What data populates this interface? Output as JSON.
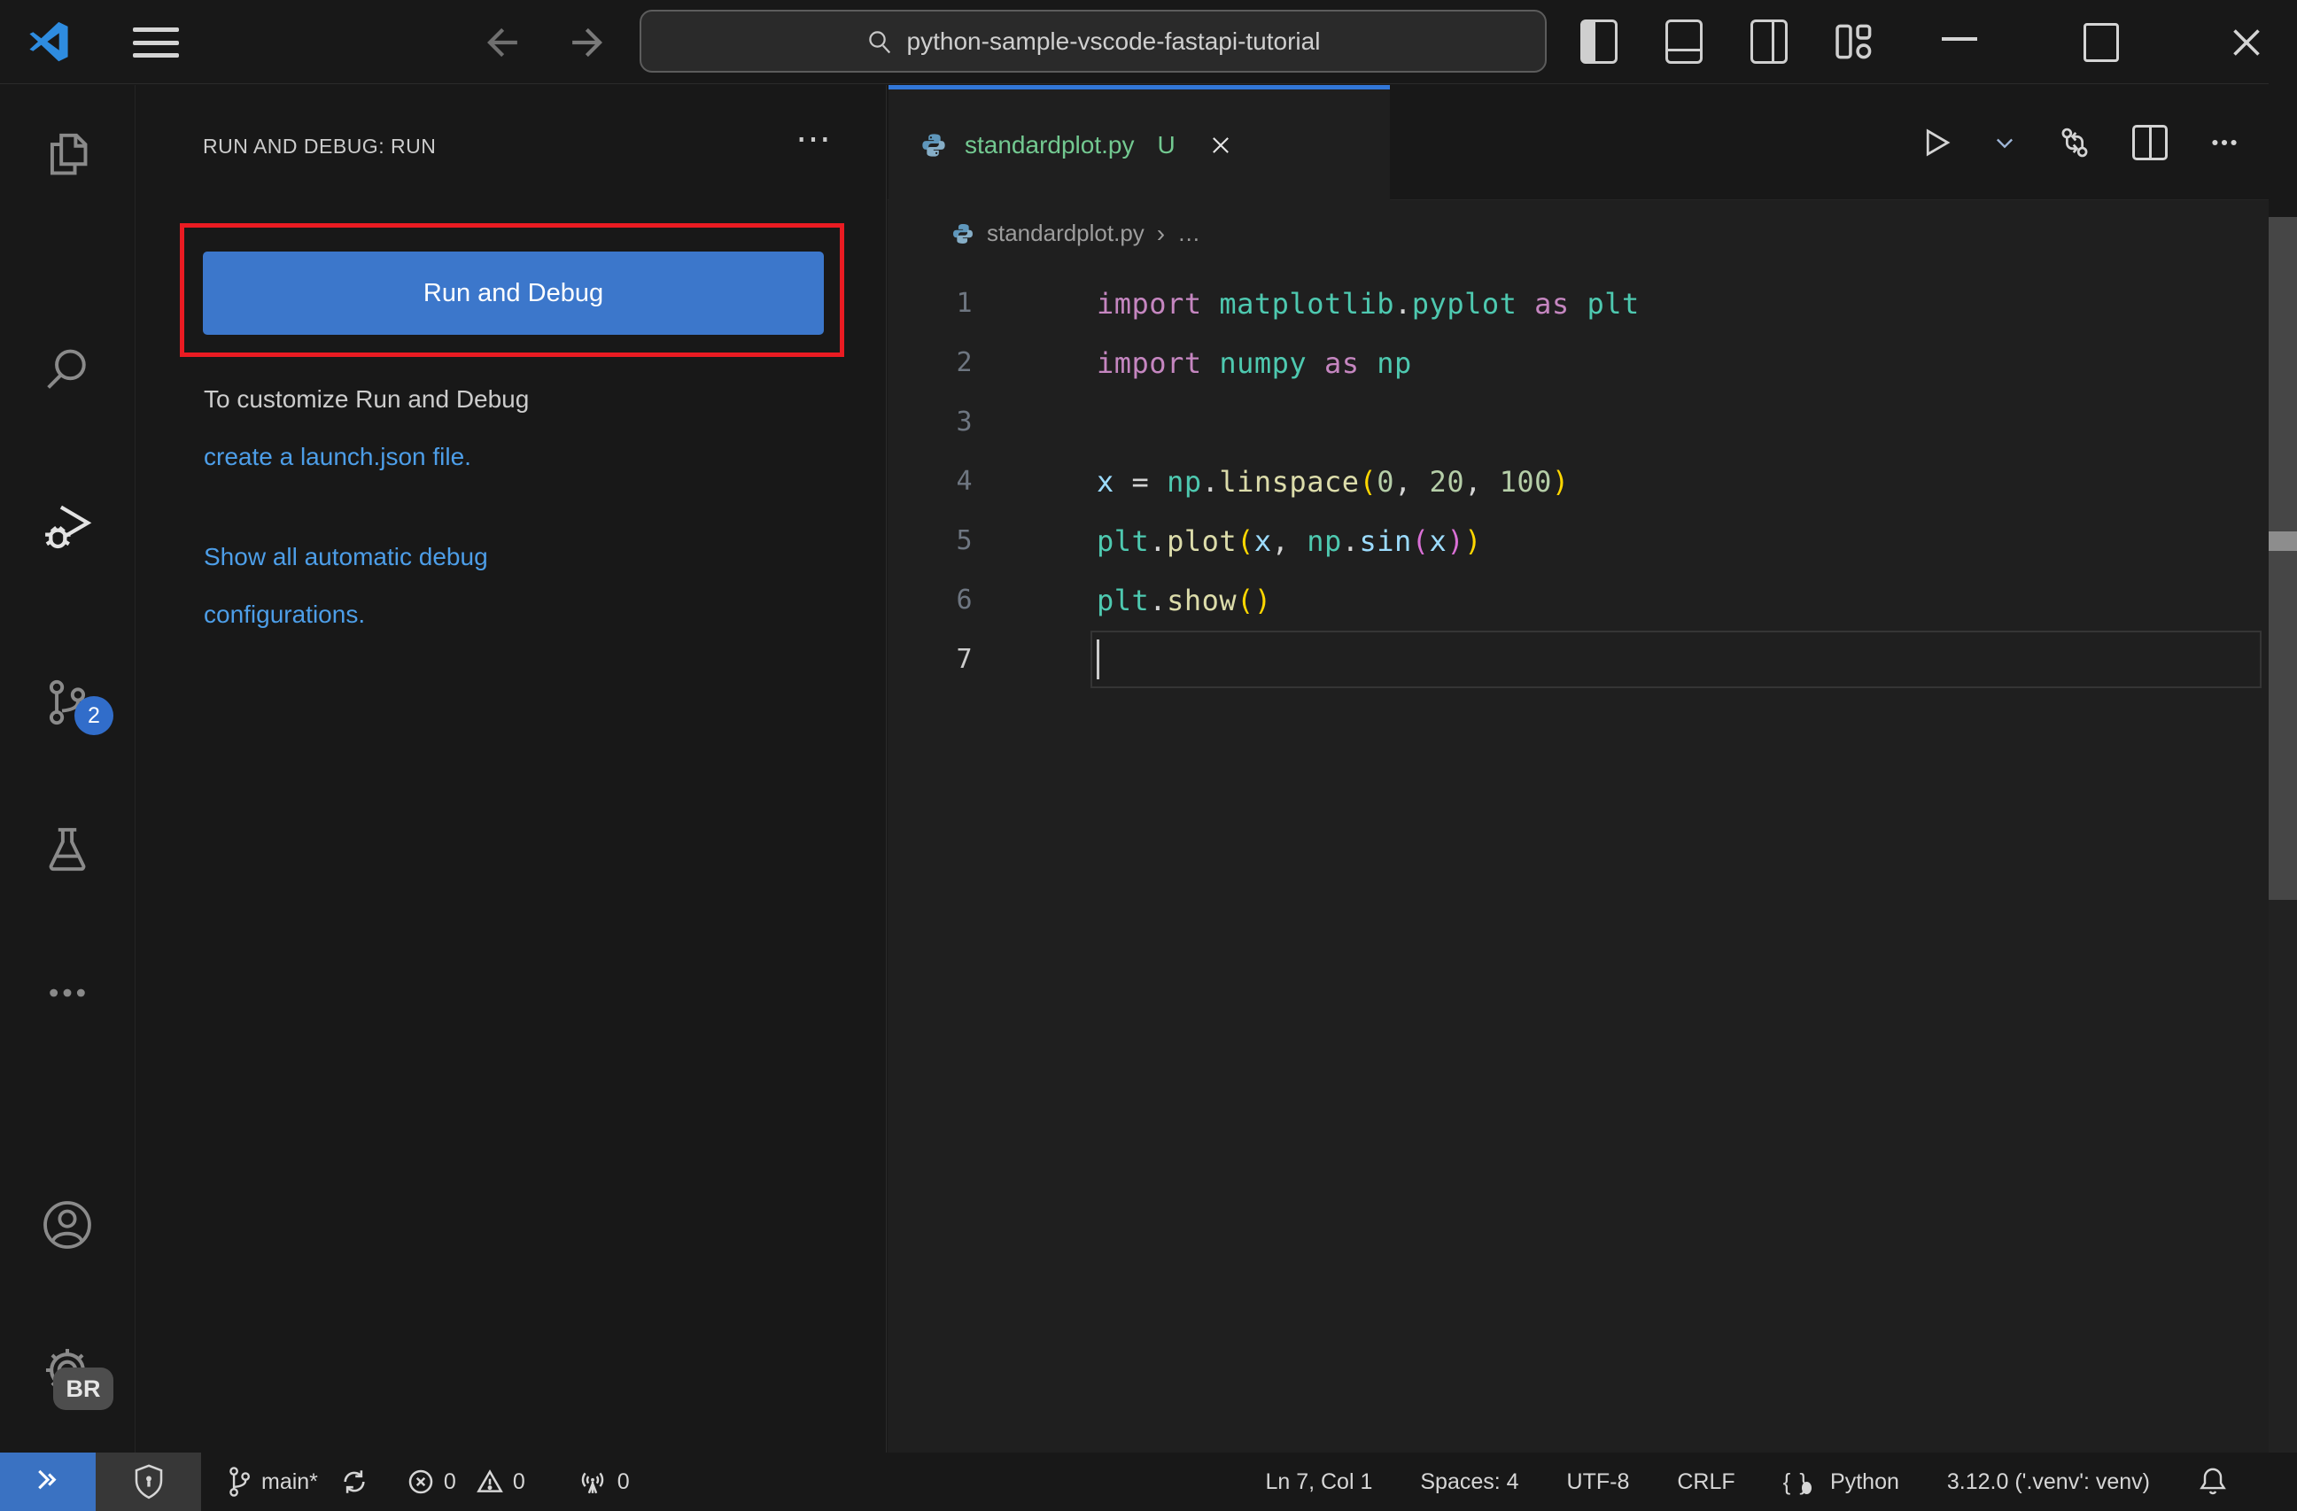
{
  "titlebar": {
    "search_value": "python-sample-vscode-fastapi-tutorial"
  },
  "activity_bar": {
    "scm_badge": "2",
    "gear_badge": "BR"
  },
  "sidebar": {
    "header": "RUN AND DEBUG: RUN",
    "more_label": "⋯",
    "run_button_label": "Run and Debug",
    "hint_text": "To customize Run and Debug",
    "hint_link": "create a launch.json file.",
    "link2_line1": "Show all automatic debug",
    "link2_line2": "configurations."
  },
  "editor": {
    "tab": {
      "name": "standardplot.py",
      "dirty_badge": "U"
    },
    "breadcrumb": {
      "file": "standardplot.py",
      "separator": "›",
      "more": "…"
    },
    "code_lines": [
      {
        "n": "1",
        "tokens": [
          [
            "import",
            "kw"
          ],
          [
            " ",
            "pl"
          ],
          [
            "matplotlib",
            "mod"
          ],
          [
            ".",
            "pl"
          ],
          [
            "pyplot",
            "mod"
          ],
          [
            " ",
            "pl"
          ],
          [
            "as",
            "kw"
          ],
          [
            " ",
            "pl"
          ],
          [
            "plt",
            "mod"
          ]
        ]
      },
      {
        "n": "2",
        "tokens": [
          [
            "import",
            "kw"
          ],
          [
            " ",
            "pl"
          ],
          [
            "numpy",
            "mod"
          ],
          [
            " ",
            "pl"
          ],
          [
            "as",
            "kw"
          ],
          [
            " ",
            "pl"
          ],
          [
            "np",
            "mod"
          ]
        ]
      },
      {
        "n": "3",
        "tokens": []
      },
      {
        "n": "4",
        "tokens": [
          [
            "x",
            "var"
          ],
          [
            " ",
            "pl"
          ],
          [
            "=",
            "pl"
          ],
          [
            " ",
            "pl"
          ],
          [
            "np",
            "mod"
          ],
          [
            ".",
            "pl"
          ],
          [
            "linspace",
            "fn"
          ],
          [
            "(",
            "b1"
          ],
          [
            "0",
            "num"
          ],
          [
            ",",
            "pl"
          ],
          [
            " ",
            "pl"
          ],
          [
            "20",
            "num"
          ],
          [
            ",",
            "pl"
          ],
          [
            " ",
            "pl"
          ],
          [
            "100",
            "num"
          ],
          [
            ")",
            "b1"
          ]
        ]
      },
      {
        "n": "5",
        "tokens": [
          [
            "plt",
            "mod"
          ],
          [
            ".",
            "pl"
          ],
          [
            "plot",
            "fn"
          ],
          [
            "(",
            "b1"
          ],
          [
            "x",
            "var"
          ],
          [
            ",",
            "pl"
          ],
          [
            " ",
            "pl"
          ],
          [
            "np",
            "mod"
          ],
          [
            ".",
            "pl"
          ],
          [
            "sin",
            "var"
          ],
          [
            "(",
            "b2"
          ],
          [
            "x",
            "var"
          ],
          [
            ")",
            "b2"
          ],
          [
            ")",
            "b1"
          ]
        ]
      },
      {
        "n": "6",
        "tokens": [
          [
            "plt",
            "mod"
          ],
          [
            ".",
            "pl"
          ],
          [
            "show",
            "fn"
          ],
          [
            "(",
            "b1"
          ],
          [
            ")",
            "b1"
          ]
        ]
      },
      {
        "n": "7",
        "tokens": [],
        "current": true
      }
    ]
  },
  "status_bar": {
    "branch": "main*",
    "errors": "0",
    "warnings": "0",
    "ports": "0",
    "cursor_position": "Ln 7, Col 1",
    "indentation": "Spaces: 4",
    "encoding": "UTF-8",
    "eol": "CRLF",
    "language_icon": "{}",
    "language": "Python",
    "interpreter": "3.12.0 ('.venv': venv)"
  },
  "colors": {
    "accent_blue": "#3c77cb",
    "tab_active_border": "#3277d8",
    "highlight_red": "#ea1b22",
    "link_blue": "#4d9ee8",
    "untracked_green": "#73c991",
    "editor_bg": "#1f1f1f",
    "chrome_bg": "#181818"
  }
}
